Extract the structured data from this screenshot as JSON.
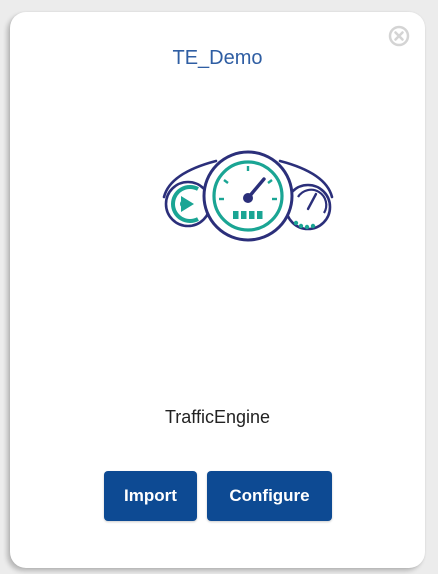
{
  "card": {
    "title": "TE_Demo",
    "app_name": "TrafficEngine",
    "logo_icon": "dashboard-gauges-icon",
    "close_icon": "close-circle-icon"
  },
  "actions": {
    "import_label": "Import",
    "configure_label": "Configure"
  },
  "colors": {
    "title": "#2f5ea3",
    "button_bg": "#0d4a93",
    "button_text": "#ffffff",
    "logo_navy": "#2b2f7a",
    "logo_teal": "#1aa594",
    "close_icon": "#d4d4d4"
  }
}
